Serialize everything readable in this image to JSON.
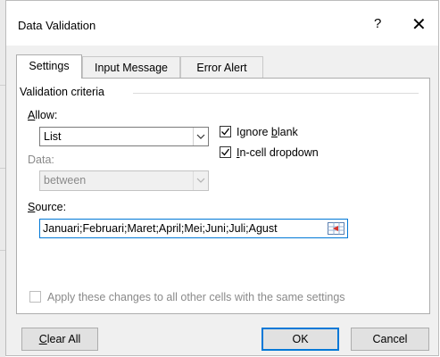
{
  "dialog": {
    "title": "Data Validation",
    "help_label": "?",
    "close_label": "✕"
  },
  "tabs": [
    {
      "label": "Settings",
      "active": true
    },
    {
      "label": "Input Message",
      "active": false
    },
    {
      "label": "Error Alert",
      "active": false
    }
  ],
  "criteria": {
    "group_label": "Validation criteria",
    "allow_label_ul": "A",
    "allow_label_rest": "llow:",
    "allow_value": "List",
    "data_label": "Data:",
    "data_value": "between",
    "ignore_blank_pre": "Ignore ",
    "ignore_blank_ul": "b",
    "ignore_blank_post": "lank",
    "ignore_blank_checked": true,
    "in_cell_ul": "I",
    "in_cell_rest": "n-cell dropdown",
    "in_cell_checked": true,
    "source_label_ul": "S",
    "source_label_rest": "ource:",
    "source_value": "Januari;Februari;Maret;April;Mei;Juni;Juli;Agust"
  },
  "apply_all": {
    "label": "Apply these changes to all other cells with the same settings",
    "checked": false
  },
  "buttons": {
    "clear_all_ul": "C",
    "clear_all_rest": "lear All",
    "ok": "OK",
    "cancel": "Cancel"
  },
  "colors": {
    "focus_blue": "#0078d7",
    "panel_bg": "#ffffff",
    "dialog_bg": "#f0f0f0"
  }
}
